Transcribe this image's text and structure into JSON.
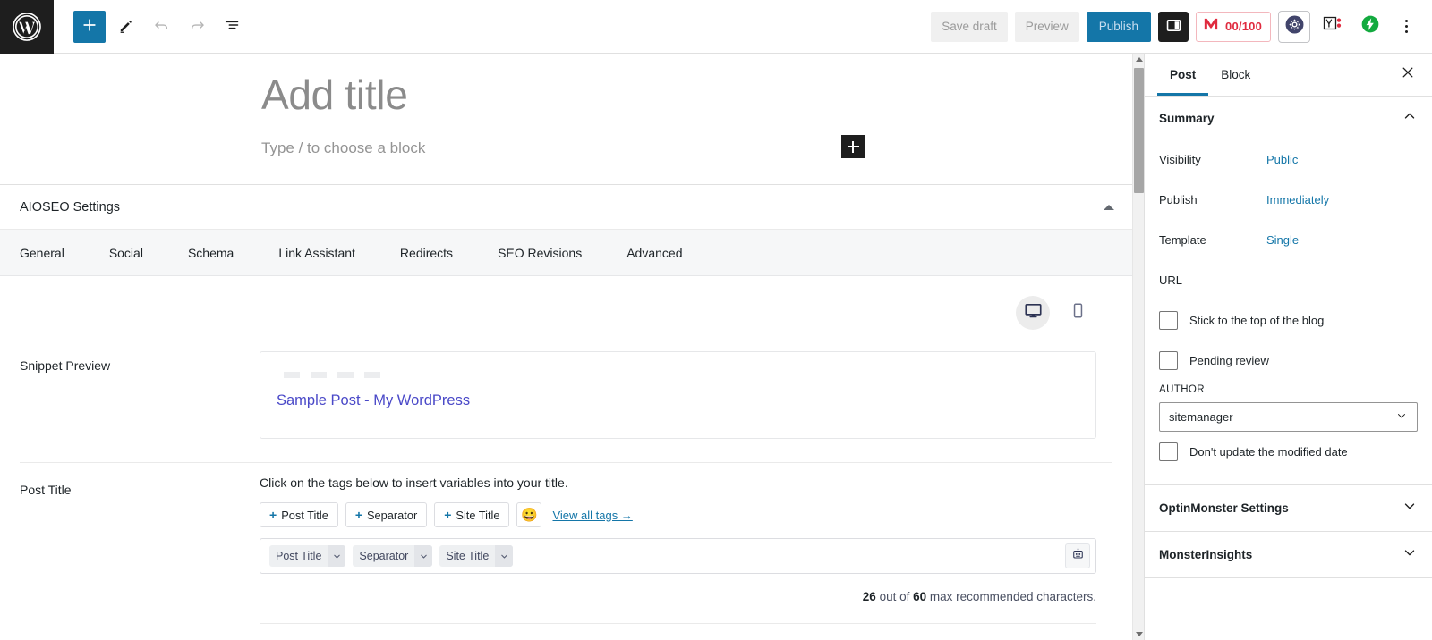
{
  "topbar": {
    "logo_icon": "wordpress-logo-icon",
    "add_block_icon": "plus-icon",
    "edit_icon": "pencil-icon",
    "undo_icon": "undo-arrow-icon",
    "redo_icon": "redo-arrow-icon",
    "list_view_icon": "document-outline-icon",
    "save_draft": "Save draft",
    "preview": "Preview",
    "publish": "Publish",
    "settings_panel_icon": "sidebar-toggle-icon",
    "seo_score": "00/100",
    "seo_score_icon": "monsterinsights-m-icon",
    "aioseo_gear_icon": "aioseo-gear-icon",
    "yoast_icon": "yoast-seo-icon",
    "bolt_icon": "green-lightning-bolt-icon",
    "kebab_icon": "more-options-icon"
  },
  "editor": {
    "title_placeholder": "Add title",
    "block_placeholder": "Type / to choose a block",
    "add_block_icon": "plus-icon"
  },
  "aioseo": {
    "panel_title": "AIOSEO Settings",
    "collapse_icon": "caret-up-icon",
    "tabs": [
      {
        "label": "General"
      },
      {
        "label": "Social"
      },
      {
        "label": "Schema"
      },
      {
        "label": "Link Assistant"
      },
      {
        "label": "Redirects"
      },
      {
        "label": "SEO Revisions"
      },
      {
        "label": "Advanced"
      }
    ],
    "device_desktop_icon": "desktop-monitor-icon",
    "device_mobile_icon": "mobile-phone-icon",
    "snippet_preview_label": "Snippet Preview",
    "snippet_title": "Sample Post - My WordPress",
    "post_title_label": "Post Title",
    "hint": "Click on the tags below to insert variables into your title.",
    "tag_buttons": [
      {
        "label": "Post Title",
        "plus": "+"
      },
      {
        "label": "Separator",
        "plus": "+"
      },
      {
        "label": "Site Title",
        "plus": "+"
      }
    ],
    "emoji_button_icon": "smiley-face-icon",
    "emoji_glyph": "😀",
    "view_all_tags": "View all tags →",
    "title_chips": [
      {
        "label": "Post Title"
      },
      {
        "label": "Separator"
      },
      {
        "label": "Site Title"
      }
    ],
    "chip_caret_icon": "chevron-down-icon",
    "robot_icon": "ai-robot-icon",
    "count_current": "26",
    "count_prefix": "out of",
    "count_max": "60",
    "count_suffix": "max recommended characters."
  },
  "sidebar": {
    "tabs": [
      {
        "label": "Post",
        "active": true
      },
      {
        "label": "Block",
        "active": false
      }
    ],
    "close_icon": "close-x-icon",
    "summary": {
      "heading": "Summary",
      "collapse_icon": "chevron-up-icon",
      "rows": [
        {
          "key": "Visibility",
          "value": "Public"
        },
        {
          "key": "Publish",
          "value": "Immediately"
        },
        {
          "key": "Template",
          "value": "Single"
        },
        {
          "key": "URL",
          "value": ""
        }
      ],
      "checkboxes": [
        {
          "label": "Stick to the top of the blog",
          "checked": false
        },
        {
          "label": "Pending review",
          "checked": false
        }
      ],
      "author_label": "AUTHOR",
      "author_value": "sitemanager",
      "author_caret_icon": "chevron-down-icon",
      "modified_date_checkbox": "Don't update the modified date"
    },
    "accordions": [
      {
        "label": "OptinMonster Settings",
        "icon": "chevron-down-icon"
      },
      {
        "label": "MonsterInsights",
        "icon": "chevron-down-icon"
      }
    ]
  },
  "colors": {
    "wp_blue": "#1476a8",
    "link_blue": "#1476a8",
    "snippet_purple": "#4a49c8",
    "score_red": "#e02b3f",
    "bolt_green": "#13aa3f"
  }
}
